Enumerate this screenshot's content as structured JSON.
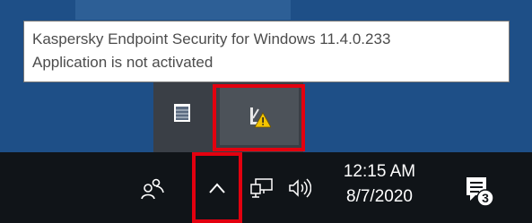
{
  "tooltip": {
    "line1": "Kaspersky Endpoint Security for Windows 11.4.0.233",
    "line2": "Application is not activated"
  },
  "overflow_panel": {
    "icons": [
      "app-window-icon",
      "kaspersky-warning-icon"
    ]
  },
  "taskbar": {
    "icons": [
      "people-icon",
      "chevron-up-icon",
      "network-icon",
      "speaker-icon",
      "action-center-icon"
    ],
    "clock": {
      "time": "12:15 AM",
      "date": "8/7/2020"
    },
    "notification_count": "3"
  },
  "colors": {
    "highlight": "#e3000f",
    "warning": "#f5c400",
    "desktop": "#1e4f87",
    "taskbar": "#101418"
  }
}
